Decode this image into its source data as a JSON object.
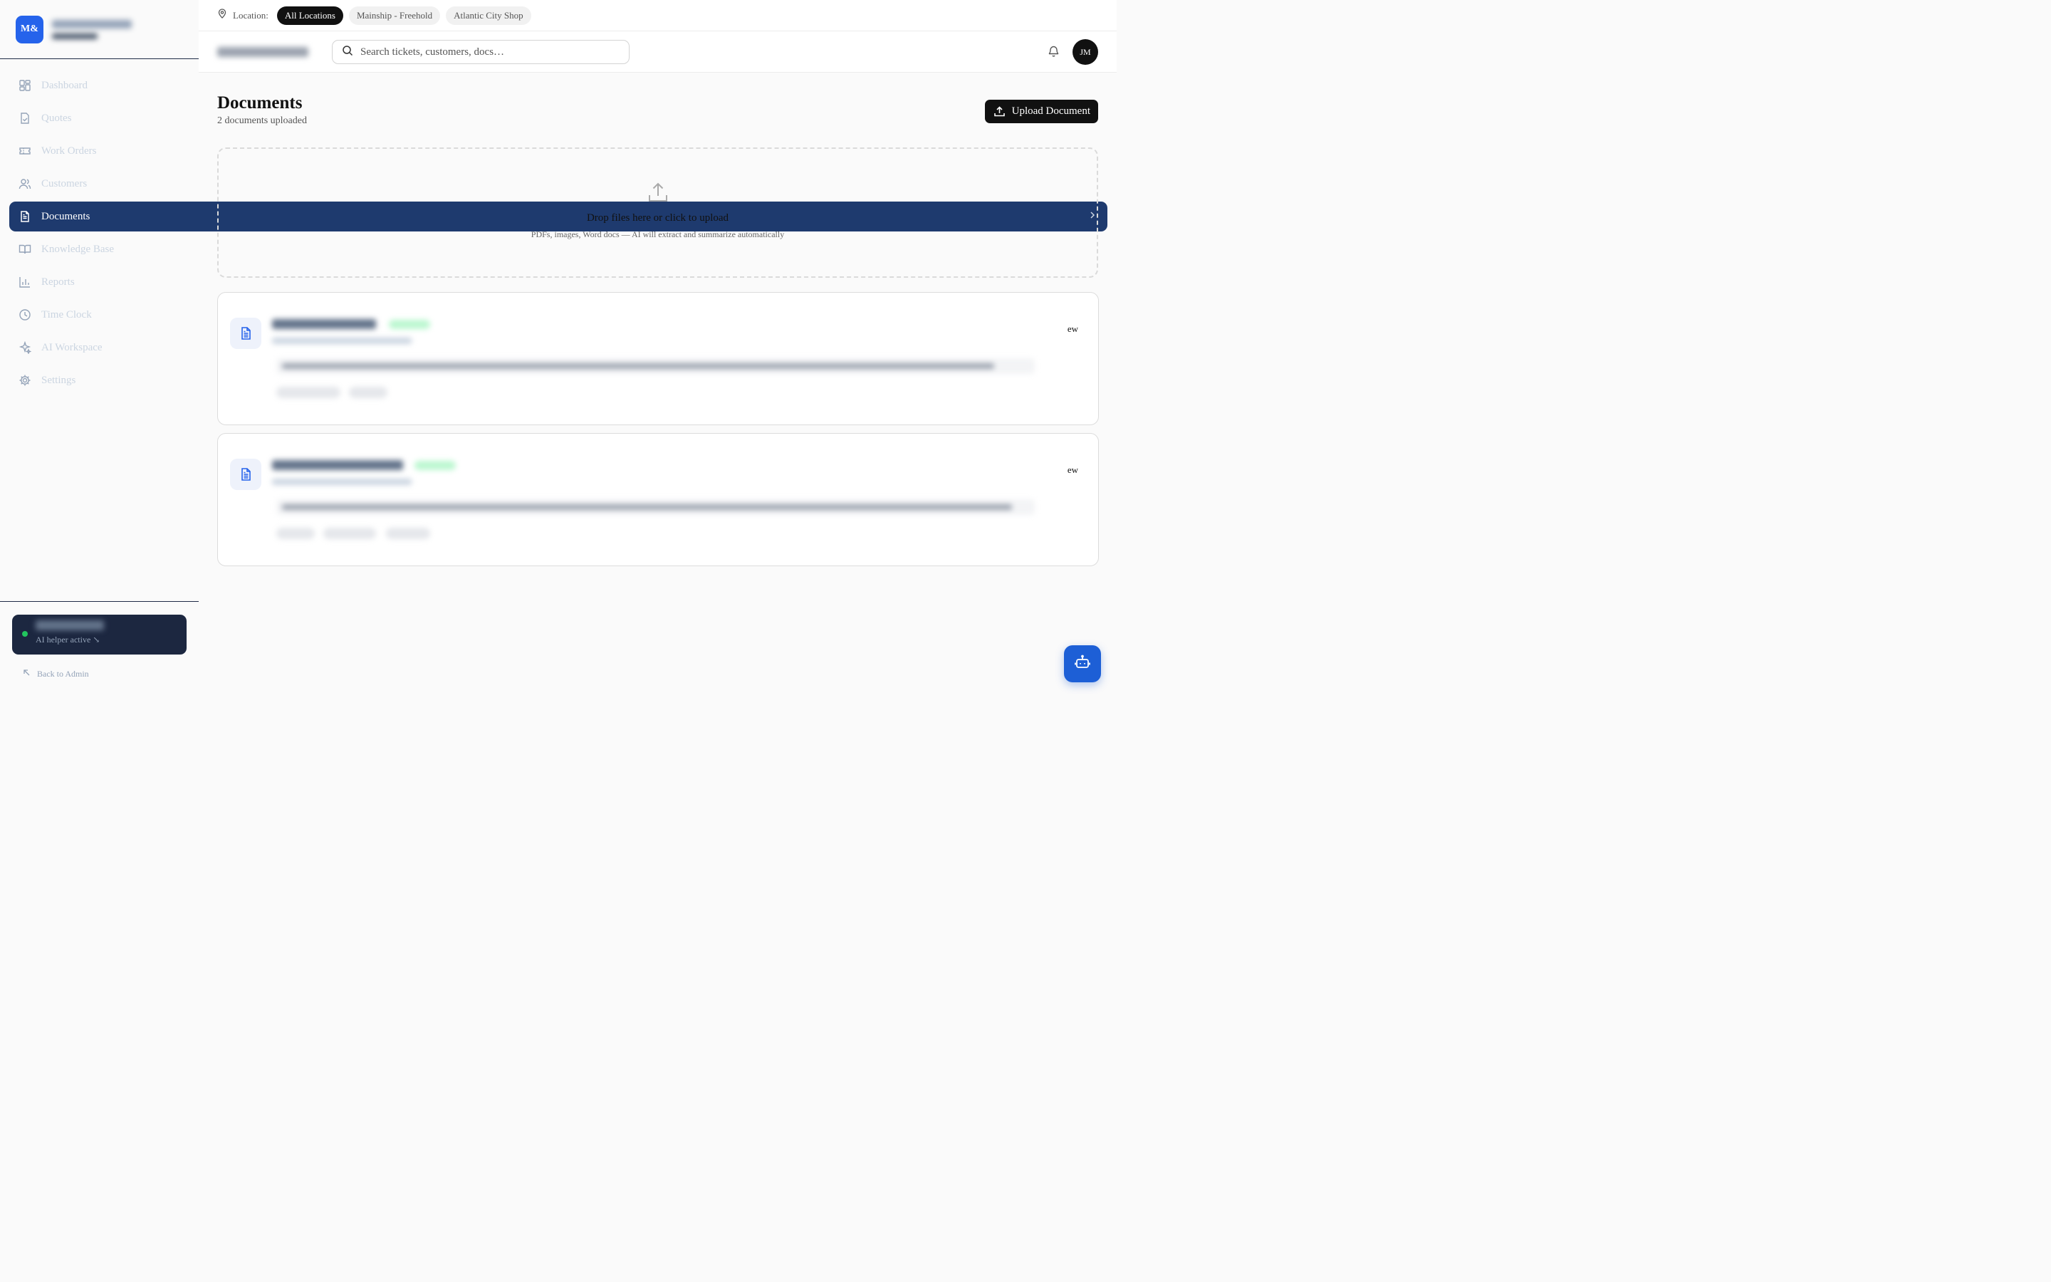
{
  "brand": {
    "logo_text": "M&",
    "name": "",
    "subtitle": ""
  },
  "sidebar": {
    "items": [
      {
        "label": "Dashboard",
        "icon": "grid-icon",
        "active": false
      },
      {
        "label": "Quotes",
        "icon": "file-check-icon",
        "active": false
      },
      {
        "label": "Work Orders",
        "icon": "ticket-icon",
        "active": false
      },
      {
        "label": "Customers",
        "icon": "users-icon",
        "active": false
      },
      {
        "label": "Documents",
        "icon": "file-text-icon",
        "active": true
      },
      {
        "label": "Knowledge Base",
        "icon": "book-icon",
        "active": false
      },
      {
        "label": "Reports",
        "icon": "bar-chart-icon",
        "active": false
      },
      {
        "label": "Time Clock",
        "icon": "clock-icon",
        "active": false
      },
      {
        "label": "AI Workspace",
        "icon": "sparkles-icon",
        "active": false
      },
      {
        "label": "Settings",
        "icon": "gear-icon",
        "active": false
      }
    ],
    "ai_helper": {
      "name": "",
      "status": "AI helper active ↘"
    },
    "back_label": "Back to Admin"
  },
  "topbar": {
    "location_label": "Location:",
    "locations": [
      {
        "label": "All Locations",
        "active": true
      },
      {
        "label": "Mainship - Freehold",
        "active": false
      },
      {
        "label": "Atlantic City Shop",
        "active": false
      }
    ]
  },
  "header": {
    "search_placeholder": "Search tickets, customers, docs…",
    "avatar_initials": "JM"
  },
  "page": {
    "title": "Documents",
    "subtitle": "2 documents uploaded",
    "upload_button": "Upload Document"
  },
  "dropzone": {
    "title": "Drop files here or click to upload",
    "subtitle": "PDFs, images, Word docs — AI will extract and summarize automatically"
  },
  "documents": [
    {
      "view_label": "ew"
    },
    {
      "view_label": "ew"
    }
  ],
  "colors": {
    "sidebar_bg": "#0f1a33",
    "accent": "#2563eb",
    "active_nav": "#1e3a6e",
    "status_green": "#22c55e"
  }
}
